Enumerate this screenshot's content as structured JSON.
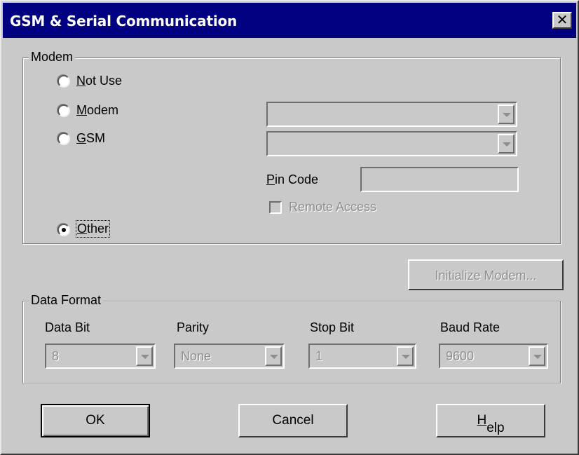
{
  "window": {
    "title": "GSM & Serial Communication",
    "close_glyph": "✕"
  },
  "modem_group": {
    "legend": "Modem",
    "options": [
      {
        "accel": "N",
        "rest": "ot Use",
        "selected": false
      },
      {
        "accel": "M",
        "rest": "odem",
        "selected": false
      },
      {
        "accel": "G",
        "rest": "SM",
        "selected": false
      },
      {
        "accel": "O",
        "rest": "ther",
        "selected": true
      }
    ],
    "modem_combo_value": "",
    "gsm_combo_value": "",
    "pin_code": {
      "accel": "P",
      "rest": "in Code",
      "value": ""
    },
    "remote_access": {
      "accel": "R",
      "rest": "emote Access",
      "checked": false,
      "enabled": false
    }
  },
  "initialize_button": {
    "label": "Initialize Modem...",
    "enabled": false
  },
  "data_format_group": {
    "legend": "Data Format",
    "fields": [
      {
        "label": "Data Bit",
        "value": "8"
      },
      {
        "label": "Parity",
        "value": "None"
      },
      {
        "label": "Stop Bit",
        "value": "1"
      },
      {
        "label": "Baud Rate",
        "value": "9600"
      }
    ]
  },
  "buttons": {
    "ok": "OK",
    "cancel": "Cancel",
    "help": {
      "accel": "H",
      "rest": "elp"
    }
  },
  "colors": {
    "titlebar": "#000080",
    "face": "#c9c9c9",
    "disabled_text": "#8e8e8e"
  }
}
